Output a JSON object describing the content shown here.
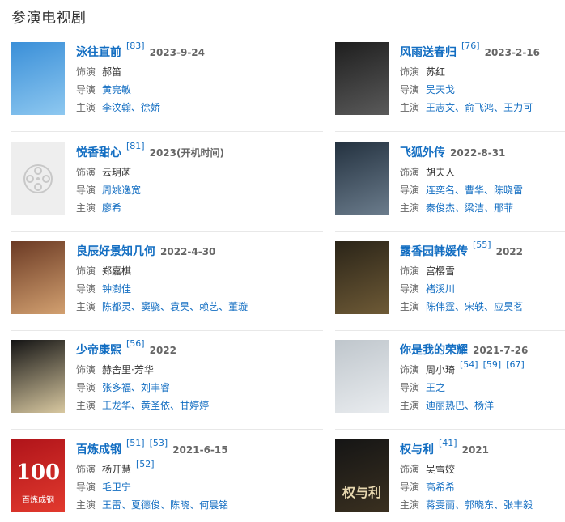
{
  "section_title": "参演电视剧",
  "cards": [
    {
      "title": "泳往直前",
      "refs": [
        "[83]"
      ],
      "date": "2023-9-24",
      "star_label": "饰演",
      "star_value": "郝笛",
      "director_label": "导演",
      "director_value": "黄亮敏",
      "cast_label": "主演",
      "cast": [
        "李汶翰",
        "徐娇"
      ],
      "poster_colors": [
        "#3a8fd8",
        "#8ec8f0"
      ]
    },
    {
      "title": "风雨送春归",
      "refs": [
        "[76]"
      ],
      "date": "2023-2-16",
      "star_label": "饰演",
      "star_value": "苏红",
      "director_label": "导演",
      "director_value": "吴天戈",
      "cast_label": "主演",
      "cast": [
        "王志文",
        "俞飞鸿",
        "王力可"
      ],
      "poster_colors": [
        "#1e1e1e",
        "#5a5a5a"
      ]
    },
    {
      "title": "悦香甜心",
      "refs": [
        "[81]"
      ],
      "date": "2023(开机时间)",
      "star_label": "饰演",
      "star_value": "云玥菡",
      "director_label": "导演",
      "director_value": "周姚逸宽",
      "cast_label": "主演",
      "cast": [
        "廖希"
      ],
      "poster_colors": [
        "#eeeeee",
        "#eeeeee"
      ]
    },
    {
      "title": "飞狐外传",
      "refs": [],
      "date": "2022-8-31",
      "star_label": "饰演",
      "star_value": "胡夫人",
      "director_label": "导演",
      "director_value": "连奕名、曹华、陈晓雷",
      "cast_label": "主演",
      "cast": [
        "秦俊杰",
        "梁洁",
        "邢菲"
      ],
      "poster_colors": [
        "#243240",
        "#6b7c8c"
      ]
    },
    {
      "title": "良辰好景知几何",
      "refs": [],
      "date": "2022-4-30",
      "star_label": "饰演",
      "star_value": "郑嘉棋",
      "director_label": "导演",
      "director_value": "钟澍佳",
      "cast_label": "主演",
      "cast": [
        "陈都灵",
        "窦骁",
        "袁昊",
        "赖艺",
        "董璇"
      ],
      "poster_colors": [
        "#6b3a24",
        "#d2a070"
      ]
    },
    {
      "title": "露香园韩媛传",
      "refs": [
        "[55]"
      ],
      "date": "2022",
      "star_label": "饰演",
      "star_value": "宫樱雪",
      "director_label": "导演",
      "director_value": "褚溪川",
      "cast_label": "主演",
      "cast": [
        "陈伟霆",
        "宋轶",
        "应昊茗"
      ],
      "poster_colors": [
        "#2a2418",
        "#6e5a36"
      ]
    },
    {
      "title": "少帝康熙",
      "refs": [
        "[56]"
      ],
      "date": "2022",
      "star_label": "饰演",
      "star_value": "赫舍里·芳华",
      "director_label": "导演",
      "director_value": "张多福、刘丰睿",
      "cast_label": "主演",
      "cast": [
        "王龙华",
        "黄圣依",
        "甘婷婷"
      ],
      "poster_colors": [
        "#141414",
        "#d8c8a0"
      ]
    },
    {
      "title": "你是我的荣耀",
      "refs": [],
      "date": "2021-7-26",
      "star_label": "饰演",
      "star_value": "周小琦",
      "star_refs": [
        "[54]",
        "[59]",
        "[67]"
      ],
      "director_label": "导演",
      "director_value": "王之",
      "cast_label": "主演",
      "cast": [
        "迪丽热巴",
        "杨洋"
      ],
      "poster_colors": [
        "#bfc6cc",
        "#e9ecef"
      ]
    },
    {
      "title": "百炼成钢",
      "refs": [
        "[51]",
        "[53]"
      ],
      "date": "2021-6-15",
      "star_label": "饰演",
      "star_value": "杨开慧",
      "star_refs": [
        "[52]"
      ],
      "director_label": "导演",
      "director_value": "毛卫宁",
      "cast_label": "主演",
      "cast": [
        "王雷",
        "夏德俊",
        "陈晓",
        "何晨铭"
      ],
      "poster_colors": [
        "#b0141a",
        "#e23a2e"
      ],
      "poster_text": "100",
      "poster_subtext": "百炼成钢"
    },
    {
      "title": "权与利",
      "refs": [
        "[41]"
      ],
      "date": "2021",
      "star_label": "饰演",
      "star_value": "吴雪姣",
      "director_label": "导演",
      "director_value": "高希希",
      "cast_label": "主演",
      "cast": [
        "蒋雯丽",
        "郭晓东",
        "张丰毅"
      ],
      "poster_colors": [
        "#151515",
        "#3a3020"
      ],
      "poster_text": "权与利"
    }
  ]
}
